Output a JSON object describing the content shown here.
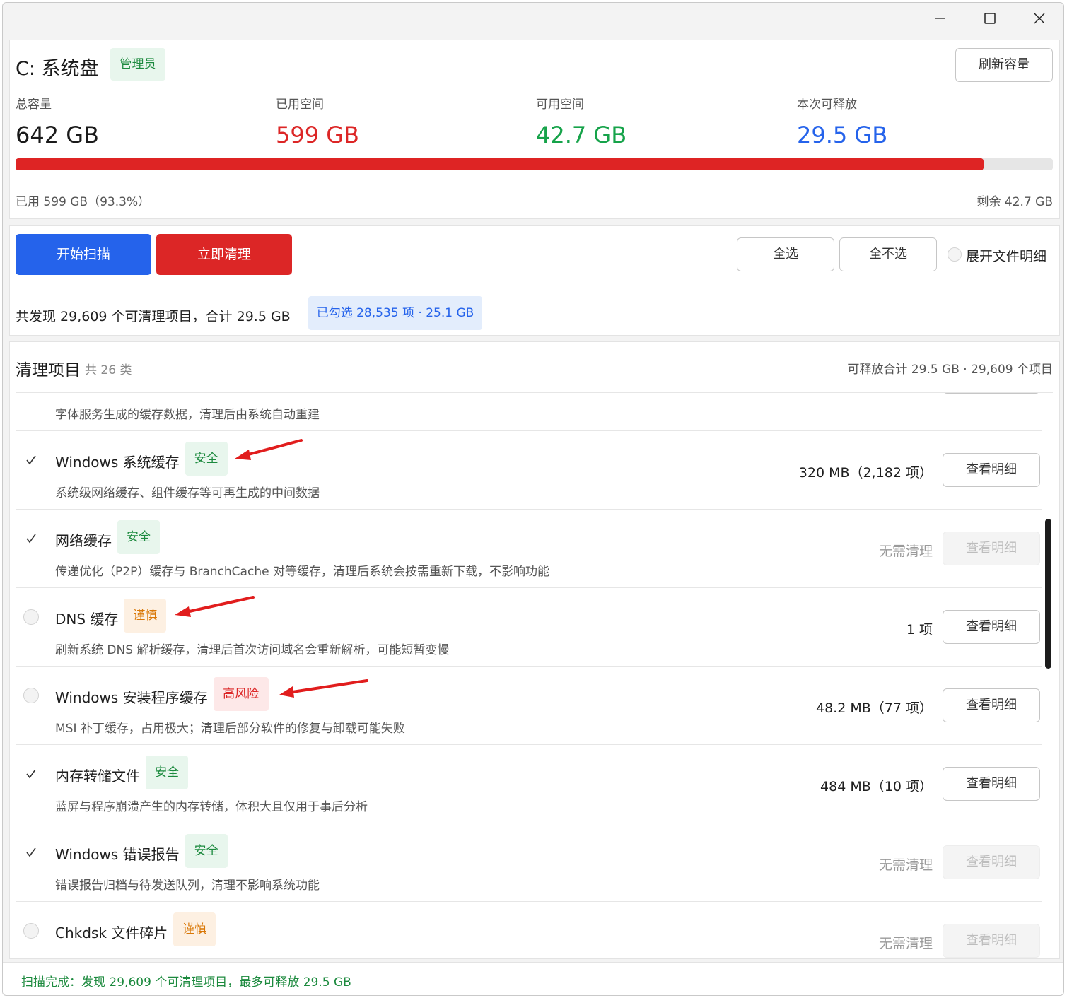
{
  "window": {
    "controls": {
      "minimize": "minimize-icon",
      "maximize": "maximize-icon",
      "close": "close-icon"
    }
  },
  "disk": {
    "title": "C: 系统盘",
    "badge": "管理员",
    "refresh_label": "刷新容量",
    "stats": [
      {
        "label": "总容量",
        "value": "642 GB",
        "color": "#1a1a1a"
      },
      {
        "label": "已用空间",
        "value": "599 GB",
        "color": "#dc2626"
      },
      {
        "label": "可用空间",
        "value": "42.7 GB",
        "color": "#16a34a"
      },
      {
        "label": "本次可释放",
        "value": "29.5 GB",
        "color": "#2563eb"
      }
    ],
    "usage_percent": 93.3,
    "used_text": "已用 599 GB（93.3%）",
    "remain_text": "剩余 42.7 GB"
  },
  "actions": {
    "scan_label": "开始扫描",
    "clean_label": "立即清理",
    "select_all_label": "全选",
    "select_none_label": "全不选",
    "expand_label": "展开文件明细",
    "found_text": "共发现 29,609 个可清理项目，合计 29.5 GB",
    "selected_text": "已勾选 28,535 项 · 25.1 GB"
  },
  "list": {
    "title": "清理项目",
    "count": "共 26 类",
    "summary": "可释放合计 29.5 GB · 29,609 个项目",
    "partial_desc": "字体服务生成的缓存数据，清理后由系统自动重建",
    "items": [
      {
        "name": "Windows 系统缓存",
        "tag": "安全",
        "tag_type": "safe",
        "desc": "系统级网络缓存、组件缓存等可再生成的中间数据",
        "size": "320 MB（2,182 项）",
        "checked": true,
        "disabled": false
      },
      {
        "name": "网络缓存",
        "tag": "安全",
        "tag_type": "safe",
        "desc": "传递优化（P2P）缓存与 BranchCache 对等缓存，清理后系统会按需重新下载，不影响功能",
        "size": "无需清理",
        "checked": true,
        "disabled": true
      },
      {
        "name": "DNS 缓存",
        "tag": "谨慎",
        "tag_type": "careful",
        "desc": "刷新系统 DNS 解析缓存，清理后首次访问域名会重新解析，可能短暂变慢",
        "size": "1 项",
        "checked": false,
        "disabled": false
      },
      {
        "name": "Windows 安装程序缓存",
        "tag": "高风险",
        "tag_type": "risk",
        "desc": "MSI 补丁缓存，占用极大；清理后部分软件的修复与卸载可能失败",
        "size": "48.2 MB（77 项）",
        "checked": false,
        "disabled": false
      },
      {
        "name": "内存转储文件",
        "tag": "安全",
        "tag_type": "safe",
        "desc": "蓝屏与程序崩溃产生的内存转储，体积大且仅用于事后分析",
        "size": "484 MB（10 项）",
        "checked": true,
        "disabled": false
      },
      {
        "name": "Windows 错误报告",
        "tag": "安全",
        "tag_type": "safe",
        "desc": "错误报告归档与待发送队列，清理不影响系统功能",
        "size": "无需清理",
        "checked": true,
        "disabled": true
      },
      {
        "name": "Chkdsk 文件碎片",
        "tag": "谨慎",
        "tag_type": "careful",
        "desc": "",
        "size": "无需清理",
        "checked": false,
        "disabled": true
      }
    ],
    "detail_label": "查看明细"
  },
  "status": {
    "text": "扫描完成：发现 29,609 个可清理项目，最多可释放 29.5 GB"
  },
  "colors": {
    "accent_blue": "#2563eb",
    "danger_red": "#dc2626",
    "success_green": "#16a34a",
    "annotation_arrow": "#e11d1d"
  }
}
